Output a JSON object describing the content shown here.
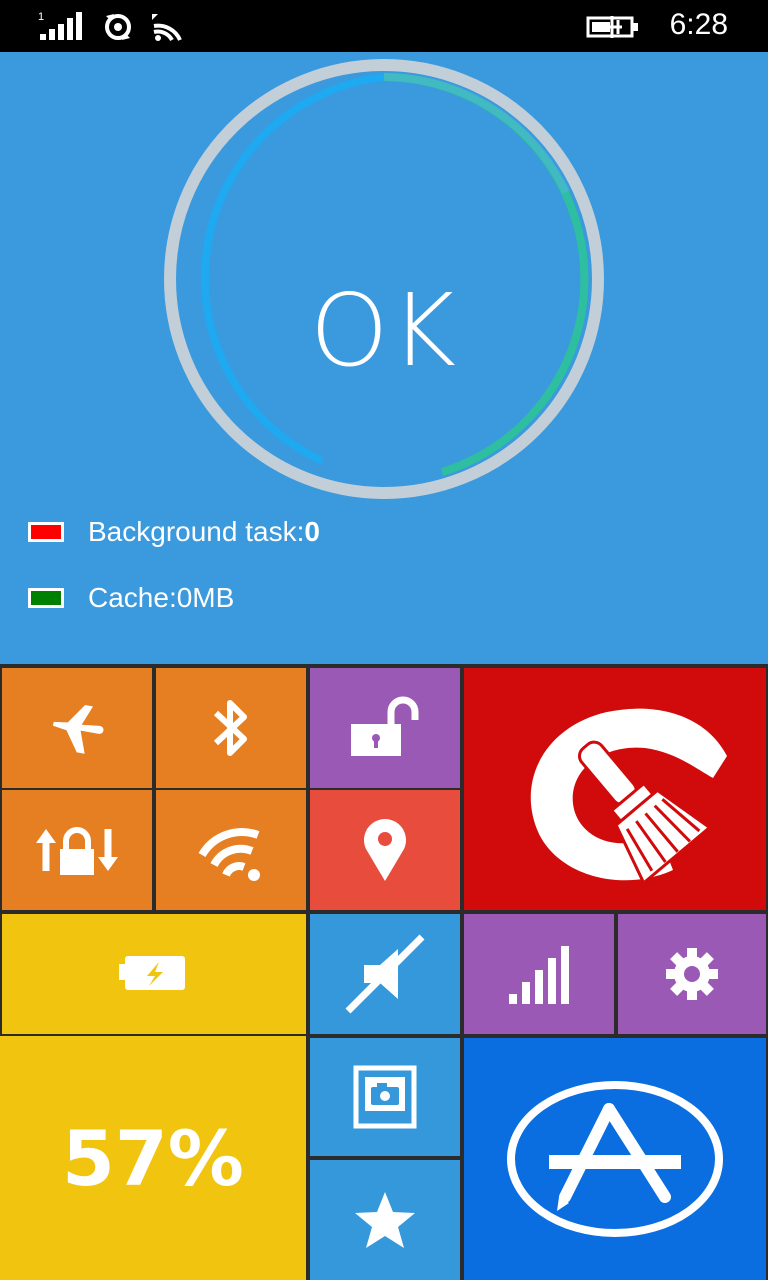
{
  "status_bar": {
    "time": "6:28",
    "icons": [
      "signal-bars-icon",
      "data-sync-icon",
      "wifi-icon",
      "battery-charging-icon"
    ],
    "signal_slot": "1"
  },
  "monitor": {
    "status_text": "OK",
    "progress_ring_colors": {
      "track": "#c3cfd8",
      "blue_arc": "#1ea9f0",
      "green_arc": "#2dbfa0"
    },
    "legend": [
      {
        "label": "Background task:",
        "value": "0",
        "color": "#ff0000"
      },
      {
        "label": "Cache:0MB",
        "value": "",
        "color": "#008000"
      }
    ]
  },
  "tiles": {
    "airplane": {
      "icon": "airplane-icon",
      "color": "#e67e22"
    },
    "bluetooth": {
      "icon": "bluetooth-icon",
      "color": "#e67e22"
    },
    "lock": {
      "icon": "unlocked-padlock-icon",
      "color": "#9b59b6"
    },
    "cleaner": {
      "icon": "cleaner-brush-icon",
      "color": "#d10b0b"
    },
    "rotation_lock": {
      "icon": "rotation-lock-icon",
      "color": "#e67e22"
    },
    "wifi": {
      "icon": "wifi-icon",
      "color": "#e67e22"
    },
    "location": {
      "icon": "location-pin-icon",
      "color": "#e74c3c"
    },
    "battery": {
      "icon": "battery-saver-icon",
      "color": "#f1c40f"
    },
    "brightness": {
      "icon": "brightness-off-icon",
      "color": "#3498db"
    },
    "cellular": {
      "icon": "cellular-signal-icon",
      "color": "#9b59b6"
    },
    "settings": {
      "icon": "gear-icon",
      "color": "#9b59b6"
    },
    "battery_percent": {
      "value": "57%",
      "color": "#f1c40f"
    },
    "camera": {
      "icon": "camera-icon",
      "color": "#3498db"
    },
    "store": {
      "icon": "app-store-icon",
      "color": "#0a6ee0"
    },
    "favorites": {
      "icon": "star-icon",
      "color": "#3498db"
    }
  }
}
